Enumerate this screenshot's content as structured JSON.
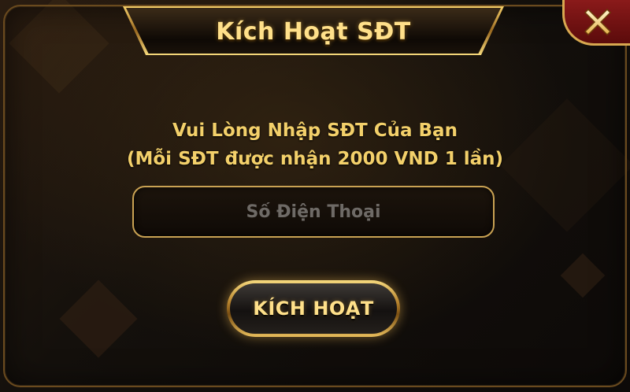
{
  "dialog": {
    "title": "Kích Hoạt SĐT",
    "instruction_line1": "Vui Lòng Nhập SĐT Của Bạn",
    "instruction_line2": "(Mỗi SĐT được nhận 2000 VND 1 lần)",
    "phone_input": {
      "placeholder": "Số Điện Thoại",
      "value": ""
    },
    "activate_label": "KÍCH HOẠT",
    "close_icon": "close-x-icon"
  },
  "colors": {
    "gold_text": "#ffe08a",
    "close_bg": "#8a1a1a",
    "field_border": "#c9a253"
  }
}
